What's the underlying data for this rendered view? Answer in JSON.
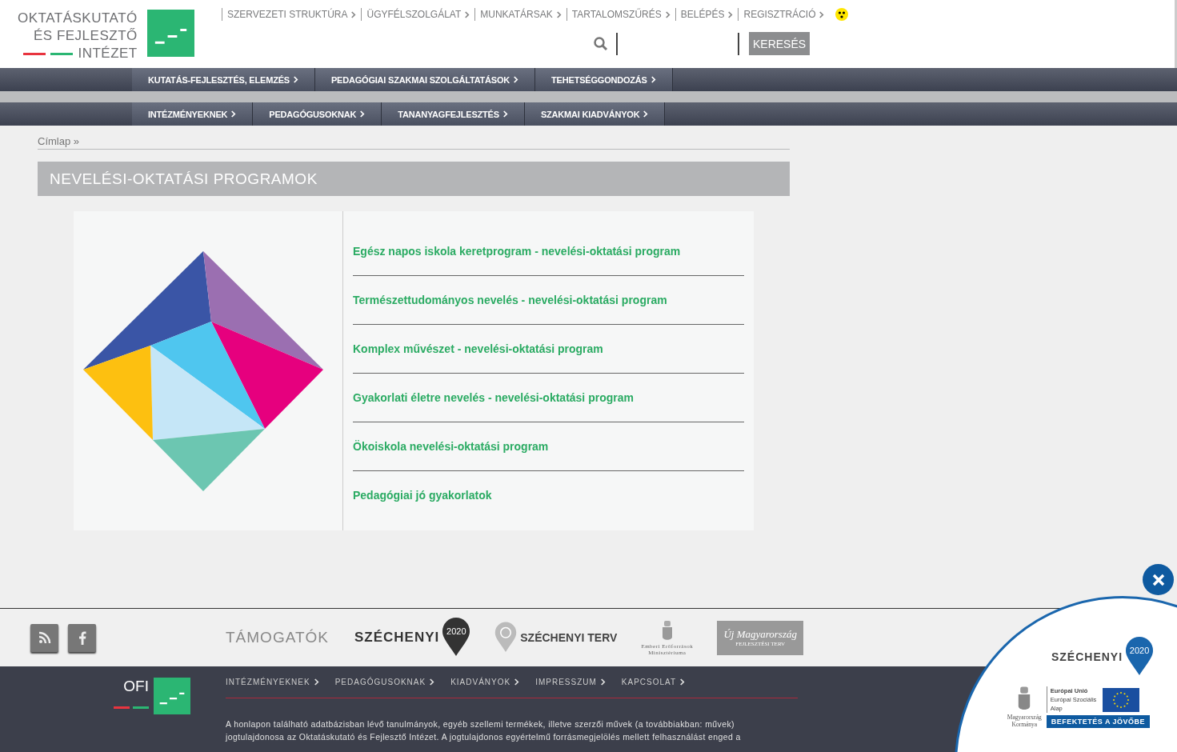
{
  "logo": {
    "lines": [
      "OKTATÁSKUTATÓ",
      "ÉS FEJLESZTŐ",
      "INTÉZET"
    ]
  },
  "top_links": [
    "SZERVEZETI STRUKTÚRA",
    "ÜGYFÉLSZOLGÁLAT",
    "MUNKATÁRSAK",
    "TARTALOMSZŰRÉS",
    "BELÉPÉS",
    "REGISZTRÁCIÓ"
  ],
  "search": {
    "button": "KERESÉS"
  },
  "nav_rows": [
    {
      "items": [
        "KUTATÁS-FEJLESZTÉS, ELEMZÉS",
        "PEDAGÓGIAI SZAKMAI SZOLGÁLTATÁSOK",
        "TEHETSÉGGONDOZÁS"
      ]
    },
    {
      "items": [
        "INTÉZMÉNYEKNEK",
        "PEDAGÓGUSOKNAK",
        "TANANYAGFEJLESZTÉS",
        "SZAKMAI KIADVÁNYOK"
      ]
    }
  ],
  "breadcrumb": "Címlap »",
  "page_title": "NEVELÉSI-OKTATÁSI PROGRAMOK",
  "programs": [
    "Egész napos iskola keretprogram - nevelési-oktatási program",
    "Természettudományos nevelés - nevelési-oktatási program",
    "Komplex művészet - nevelési-oktatási program",
    "Gyakorlati életre nevelés - nevelési-oktatási program",
    "Ökoiskola nevelési-oktatási program",
    "Pedagógiai jó gyakorlatok"
  ],
  "supporters": {
    "label": "TÁMOGATÓK",
    "szechenyi2020": {
      "name": "SZÉCHENYI",
      "year": "2020"
    },
    "szechenyi_terv": "SZÉCHENYI TERV",
    "emmi": [
      "Emberi Erőforrások",
      "Minisztériuma"
    ],
    "uj_magyarorszag": {
      "name": "Új Magyarország",
      "sub": "FEJLESZTÉSI TERV"
    }
  },
  "footer": {
    "ofi": "OFI",
    "links": [
      "INTÉZMÉNYEKNEK",
      "PEDAGÓGUSOKNAK",
      "KIADVÁNYOK",
      "IMPRESSZUM",
      "KAPCSOLAT"
    ],
    "notice_lines": [
      "A honlapon található adatbázisban lévő tanulmányok, egyéb szellemi termékek, illetve szerzői művek (a továbbiakban: művek)",
      "jogtulajdonosa az Oktatáskutató és Fejlesztő Intézet. A jogtulajdonos egyértelmű forrásmegjelölés mellett felhasználást enged a"
    ]
  },
  "overlay": {
    "name": "SZÉCHENYI",
    "year": "2020",
    "government": [
      "Magyarország",
      "Kormánya"
    ],
    "eu": [
      "Európai Unió",
      "Európai Szociális",
      "Alap"
    ],
    "slogan": "BEFEKTETÉS A JÖVŐBE"
  }
}
